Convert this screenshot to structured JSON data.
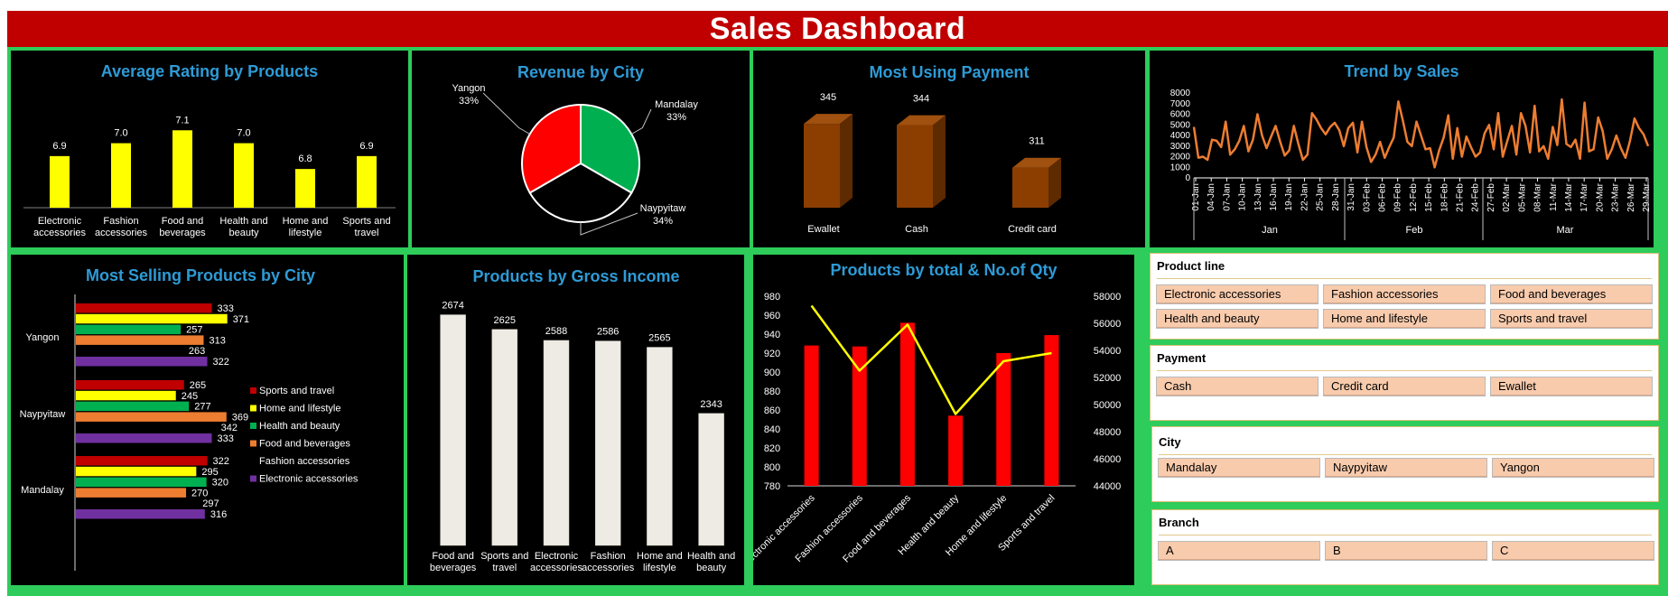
{
  "dashboard_title": "Sales Dashboard",
  "chart_data": [
    {
      "id": "rating",
      "type": "bar",
      "title": "Average Rating by Products",
      "categories": [
        "Electronic accessories",
        "Fashion accessories",
        "Food and beverages",
        "Health and beauty",
        "Home and lifestyle",
        "Sports and travel"
      ],
      "category_lines": [
        [
          "Electronic",
          "accessories"
        ],
        [
          "Fashion",
          "accessories"
        ],
        [
          "Food and",
          "beverages"
        ],
        [
          "Health and",
          "beauty"
        ],
        [
          "Home and",
          "lifestyle"
        ],
        [
          "Sports and",
          "travel"
        ]
      ],
      "values": [
        6.9,
        7.0,
        7.1,
        7.0,
        6.8,
        6.9
      ],
      "value_labels": [
        "6.9",
        "7.0",
        "7.1",
        "7.0",
        "6.8",
        "6.9"
      ],
      "ylim": [
        6.5,
        7.2
      ],
      "color": "#ffff00",
      "axis_visible": false
    },
    {
      "id": "city_revenue",
      "type": "pie",
      "title": "Revenue by City",
      "labels": [
        "Mandalay",
        "Naypyitaw",
        "Yangon"
      ],
      "values": [
        33,
        34,
        33
      ],
      "value_labels": [
        "33%",
        "34%",
        "33%"
      ],
      "colors": [
        "#00b050",
        "#000000",
        "#ff0000"
      ],
      "slice_border": "#ffffff"
    },
    {
      "id": "payment",
      "type": "bar",
      "title": "Most Using Payment",
      "categories": [
        "Ewallet",
        "Cash",
        "Credit card"
      ],
      "values": [
        345,
        344,
        311
      ],
      "value_labels": [
        "345",
        "344",
        "311"
      ],
      "ylim": [
        280,
        350
      ],
      "color": "#8b3e00",
      "style": "3d",
      "axis_visible": false
    },
    {
      "id": "trend",
      "type": "line",
      "title": "Trend by Sales",
      "y_ticks": [
        0,
        1000,
        2000,
        3000,
        4000,
        5000,
        6000,
        7000,
        8000
      ],
      "ylim": [
        0,
        8000
      ],
      "x_tick_labels": [
        "01-Jan",
        "04-Jan",
        "07-Jan",
        "10-Jan",
        "13-Jan",
        "16-Jan",
        "19-Jan",
        "22-Jan",
        "25-Jan",
        "28-Jan",
        "31-Jan",
        "03-Feb",
        "06-Feb",
        "09-Feb",
        "12-Feb",
        "15-Feb",
        "18-Feb",
        "21-Feb",
        "24-Feb",
        "27-Feb",
        "02-Mar",
        "05-Mar",
        "08-Mar",
        "11-Mar",
        "14-Mar",
        "17-Mar",
        "20-Mar",
        "23-Mar",
        "26-Mar",
        "29-Mar"
      ],
      "month_labels": [
        "Jan",
        "Feb",
        "Mar"
      ],
      "color": "#ed7d31",
      "values": [
        4800,
        1900,
        2000,
        1700,
        3600,
        3500,
        2900,
        5300,
        2200,
        2700,
        3500,
        4900,
        2500,
        3600,
        6000,
        4000,
        2800,
        3900,
        4900,
        3400,
        2100,
        2600,
        4900,
        3200,
        1700,
        2200,
        6100,
        5500,
        4700,
        4100,
        4800,
        5200,
        4500,
        3000,
        4700,
        5200,
        2400,
        5300,
        2900,
        1500,
        2200,
        3400,
        1900,
        2900,
        3800,
        7200,
        5400,
        3400,
        3000,
        5300,
        4000,
        2700,
        2800,
        1000,
        2600,
        3800,
        5900,
        1800,
        4700,
        2000,
        3900,
        2900,
        2000,
        2400,
        4200,
        5000,
        2700,
        6100,
        2000,
        3500,
        4900,
        2200,
        6100,
        4900,
        2400,
        6800,
        2500,
        3000,
        1800,
        4800,
        3100,
        7400,
        3200,
        2900,
        3600,
        1800,
        7100,
        2500,
        2700,
        5700,
        4400,
        1800,
        2700,
        4000,
        2800,
        1900,
        3500,
        5600,
        4700,
        4100,
        3000
      ]
    },
    {
      "id": "selling_city",
      "type": "bar",
      "orientation": "horizontal",
      "title": "Most Selling Products by City",
      "categories": [
        "Yangon",
        "Naypyitaw",
        "Mandalay"
      ],
      "series": [
        {
          "name": "Sports and travel",
          "color": "#c00000",
          "values": [
            333,
            265,
            322
          ]
        },
        {
          "name": "Home and lifestyle",
          "color": "#ffff00",
          "values": [
            371,
            245,
            295
          ]
        },
        {
          "name": "Health and beauty",
          "color": "#00b050",
          "values": [
            257,
            277,
            320
          ]
        },
        {
          "name": "Food and beverages",
          "color": "#ed7d31",
          "values": [
            313,
            369,
            270
          ]
        },
        {
          "name": "Fashion accessories",
          "color": "#000000",
          "values": [
            263,
            342,
            297
          ]
        },
        {
          "name": "Electronic accessories",
          "color": "#7030a0",
          "values": [
            322,
            333,
            316
          ]
        }
      ],
      "xlim": [
        0,
        380
      ],
      "axis_visible": false
    },
    {
      "id": "gross_income",
      "type": "bar",
      "title": "Products by Gross Income",
      "categories": [
        "Food and beverages",
        "Sports and travel",
        "Electronic accessories",
        "Fashion accessories",
        "Home and lifestyle",
        "Health and beauty"
      ],
      "category_lines": [
        [
          "Food and",
          "beverages"
        ],
        [
          "Sports and",
          "travel"
        ],
        [
          "Electronic",
          "accessories"
        ],
        [
          "Fashion",
          "accessories"
        ],
        [
          "Home and",
          "lifestyle"
        ],
        [
          "Health and",
          "beauty"
        ]
      ],
      "values": [
        2674,
        2625,
        2588,
        2586,
        2565,
        2343
      ],
      "value_labels": [
        "2674",
        "2625",
        "2588",
        "2586",
        "2565",
        "2343"
      ],
      "ylim": [
        1900,
        2700
      ],
      "color": "#eeebe4",
      "axis_visible": false
    },
    {
      "id": "total_qty",
      "type": "bar",
      "title": "Products by total & No.of Qty",
      "categories": [
        "Electronic accessories",
        "Fashion accessories",
        "Food and beverages",
        "Health and beauty",
        "Home and lifestyle",
        "Sports and travel"
      ],
      "series": [
        {
          "values": [
            928,
            927,
            952,
            854,
            920,
            939
          ],
          "axis": "left",
          "type": "bar",
          "color": "#ff0000"
        },
        {
          "values": [
            57300,
            52500,
            55900,
            49300,
            53200,
            53800
          ],
          "axis": "right",
          "type": "line",
          "color": "#ffff00"
        }
      ],
      "ylim_left": [
        780,
        980
      ],
      "yticks_left": [
        780,
        800,
        820,
        840,
        860,
        880,
        900,
        920,
        940,
        960,
        980
      ],
      "ylim_right": [
        44000,
        58000
      ],
      "yticks_right": [
        44000,
        46000,
        48000,
        50000,
        52000,
        54000,
        56000,
        58000
      ]
    }
  ],
  "slicers": [
    {
      "title": "Product line",
      "items": [
        "Electronic accessories",
        "Fashion accessories",
        "Food and beverages",
        "Health and beauty",
        "Home and lifestyle",
        "Sports and travel"
      ]
    },
    {
      "title": "Payment",
      "items": [
        "Cash",
        "Credit card",
        "Ewallet"
      ]
    },
    {
      "title": "City",
      "items": [
        "Mandalay",
        "Naypyitaw",
        "Yangon"
      ]
    },
    {
      "title": "Branch",
      "items": [
        "A",
        "B",
        "C"
      ]
    }
  ]
}
